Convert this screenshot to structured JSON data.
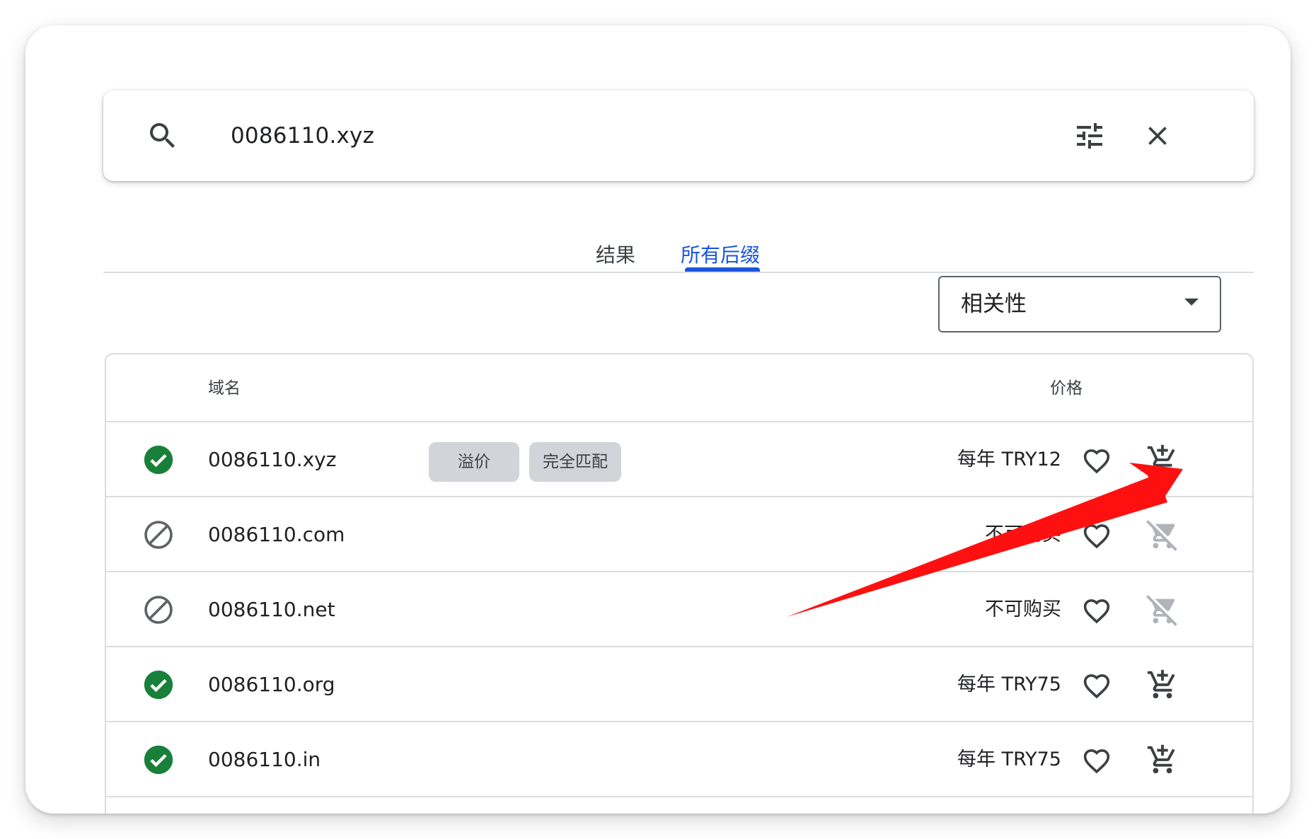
{
  "search": {
    "value": "0086110.xyz"
  },
  "tabs": [
    {
      "label": "结果",
      "active": false
    },
    {
      "label": "所有后缀",
      "active": true
    }
  ],
  "sort": {
    "selected": "相关性"
  },
  "table": {
    "headers": {
      "domain": "域名",
      "price": "价格"
    },
    "rows": [
      {
        "status": "available",
        "domain": "0086110.xyz",
        "chips": [
          "溢价",
          "完全匹配"
        ],
        "price": "每年 TRY12",
        "cart_enabled": true
      },
      {
        "status": "unavailable",
        "domain": "0086110.com",
        "chips": [],
        "price": "不可购买",
        "cart_enabled": false
      },
      {
        "status": "unavailable",
        "domain": "0086110.net",
        "chips": [],
        "price": "不可购买",
        "cart_enabled": false
      },
      {
        "status": "available",
        "domain": "0086110.org",
        "chips": [],
        "price": "每年 TRY75",
        "cart_enabled": true
      },
      {
        "status": "available",
        "domain": "0086110.in",
        "chips": [],
        "price": "每年 TRY75",
        "cart_enabled": true
      }
    ]
  },
  "colors": {
    "accent": "#1a56db",
    "available": "#188038",
    "unavailable": "#5f6368",
    "annotation_arrow": "#ff1010"
  },
  "icons": {
    "search": "search-icon",
    "filter": "tune-icon",
    "clear": "close-icon",
    "available": "check-circle-icon",
    "unavailable": "block-icon",
    "favorite": "heart-outline-icon",
    "add_to_cart": "add-shopping-cart-icon",
    "cart_disabled": "remove-shopping-cart-icon"
  }
}
